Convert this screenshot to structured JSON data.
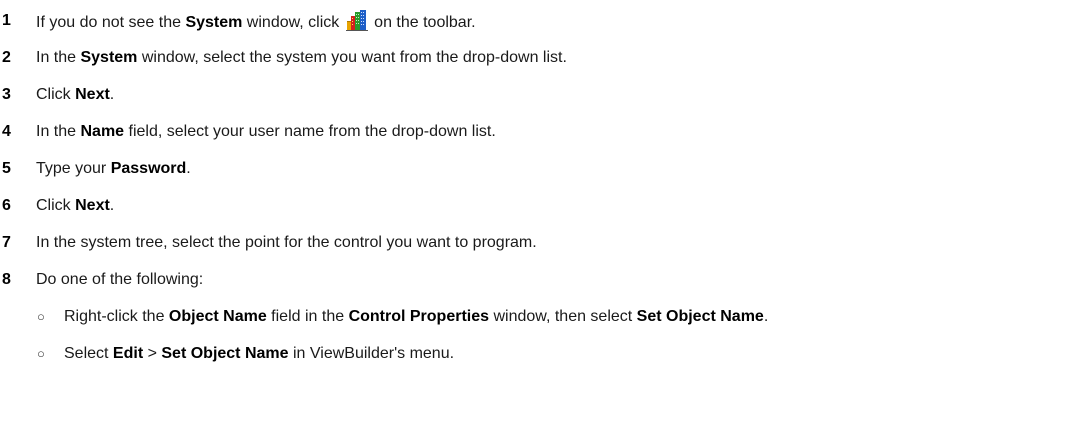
{
  "steps": [
    {
      "number": "1",
      "parts": [
        "If you do not see the ",
        "System",
        " window, click ",
        " on the toolbar."
      ],
      "icon": "system-toolbar-icon"
    },
    {
      "number": "2",
      "parts": [
        "In the ",
        "System",
        " window, select the system you want from the drop-down list."
      ]
    },
    {
      "number": "3",
      "parts": [
        "Click ",
        "Next",
        "."
      ]
    },
    {
      "number": "4",
      "parts": [
        "In the ",
        "Name",
        " field, select your user name from the drop-down list."
      ]
    },
    {
      "number": "5",
      "parts": [
        "Type your ",
        "Password",
        "."
      ]
    },
    {
      "number": "6",
      "parts": [
        "Click ",
        "Next",
        "."
      ]
    },
    {
      "number": "7",
      "parts": [
        "In the system tree, select the point for the control you want to program."
      ]
    },
    {
      "number": "8",
      "parts": [
        "Do one of the following:"
      ]
    }
  ],
  "sub_items": [
    {
      "bullet": "○",
      "parts": [
        "Right-click the ",
        "Object Name",
        " field in the ",
        "Control Properties",
        " window, then select ",
        "Set Object Name",
        "."
      ]
    },
    {
      "bullet": "○",
      "parts": [
        "Select ",
        "Edit",
        " > ",
        "Set Object Name",
        " in ViewBuilder's menu."
      ]
    }
  ]
}
